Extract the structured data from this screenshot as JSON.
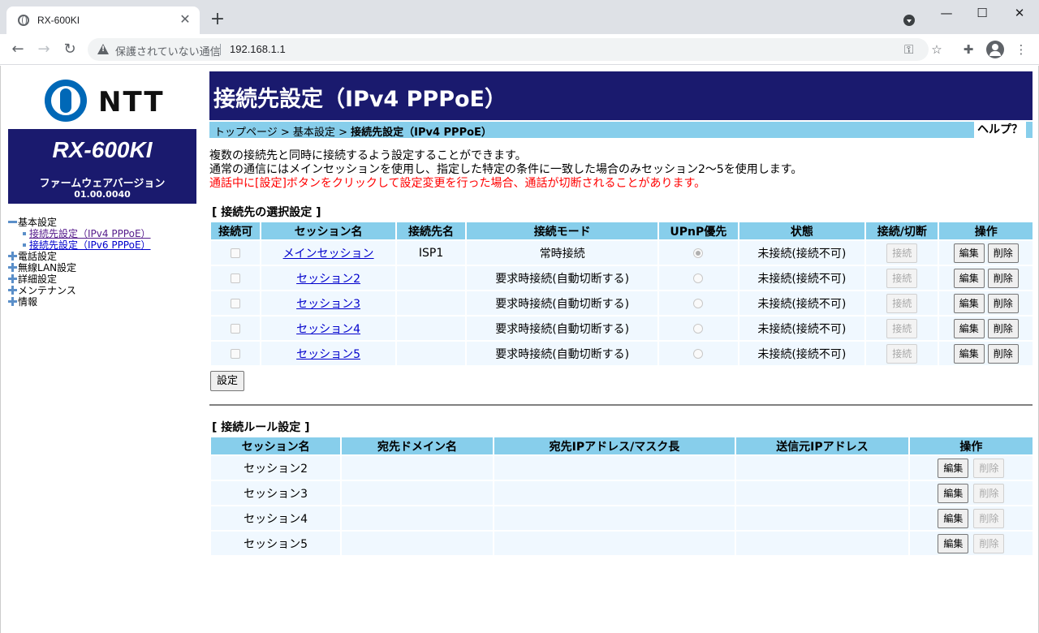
{
  "browser": {
    "tab_title": "RX-600KI",
    "tab_close": "✕",
    "new_tab": "+",
    "not_secure_label": "保護されていない通信",
    "url": "192.168.1.1",
    "window_controls": [
      "—",
      "☐",
      "✕"
    ]
  },
  "sidebar": {
    "logo_text": "NTT",
    "model_name": "RX-600KI",
    "firmware_label": "ファームウェアバージョン",
    "firmware_version": "01.00.0040",
    "nav": [
      {
        "label": "基本設定",
        "expanded": true,
        "children": [
          {
            "label": "接続先設定（IPv4 PPPoE）"
          },
          {
            "label": "接続先設定（IPv6 PPPoE）"
          }
        ]
      },
      {
        "label": "電話設定",
        "expanded": false
      },
      {
        "label": "無線LAN設定",
        "expanded": false
      },
      {
        "label": "詳細設定",
        "expanded": false
      },
      {
        "label": "メンテナンス",
        "expanded": false
      },
      {
        "label": "情報",
        "expanded": false
      }
    ]
  },
  "main": {
    "title": "接続先設定（IPv4 PPPoE）",
    "breadcrumb": {
      "top": "トップページ",
      "sep": " > ",
      "basic": "基本設定",
      "current": "接続先設定（IPv4 PPPoE）"
    },
    "help": "ヘルプ？",
    "description": [
      "複数の接続先と同時に接続するよう設定することができます。",
      "通常の通信にはメインセッションを使用し、指定した特定の条件に一致した場合のみセッション2～5を使用します。"
    ],
    "warning": "通話中に[設定]ボタンをクリックして設定変更を行った場合、通話が切断されることがあります。",
    "selection_section": {
      "title": "[ 接続先の選択設定 ]",
      "headers": [
        "接続可",
        "セッション名",
        "接続先名",
        "接続モード",
        "UPnP優先",
        "状態",
        "接続/切断",
        "操作"
      ],
      "rows": [
        {
          "session": "メインセッション",
          "dest": "ISP1",
          "mode": "常時接続",
          "upnp": true,
          "status": "未接続(接続不可)"
        },
        {
          "session": "セッション2",
          "dest": "",
          "mode": "要求時接続(自動切断する)",
          "upnp": false,
          "status": "未接続(接続不可)"
        },
        {
          "session": "セッション3",
          "dest": "",
          "mode": "要求時接続(自動切断する)",
          "upnp": false,
          "status": "未接続(接続不可)"
        },
        {
          "session": "セッション4",
          "dest": "",
          "mode": "要求時接続(自動切断する)",
          "upnp": false,
          "status": "未接続(接続不可)"
        },
        {
          "session": "セッション5",
          "dest": "",
          "mode": "要求時接続(自動切断する)",
          "upnp": false,
          "status": "未接続(接続不可)"
        }
      ],
      "connect_label": "接続",
      "edit_label": "編集",
      "delete_label": "削除"
    },
    "set_button": "設定",
    "rule_section": {
      "title": "[ 接続ルール設定 ]",
      "headers": [
        "セッション名",
        "宛先ドメイン名",
        "宛先IPアドレス/マスク長",
        "送信元IPアドレス",
        "操作"
      ],
      "rows": [
        {
          "session": "セッション2",
          "domain": "",
          "dest_ip": "",
          "src_ip": ""
        },
        {
          "session": "セッション3",
          "domain": "",
          "dest_ip": "",
          "src_ip": ""
        },
        {
          "session": "セッション4",
          "domain": "",
          "dest_ip": "",
          "src_ip": ""
        },
        {
          "session": "セッション5",
          "domain": "",
          "dest_ip": "",
          "src_ip": ""
        }
      ],
      "edit_label": "編集",
      "delete_label": "削除"
    }
  },
  "colors": {
    "header_navy": "#1a1a6e",
    "header_sky": "#87ceeb",
    "warning_red": "#ff0000"
  }
}
